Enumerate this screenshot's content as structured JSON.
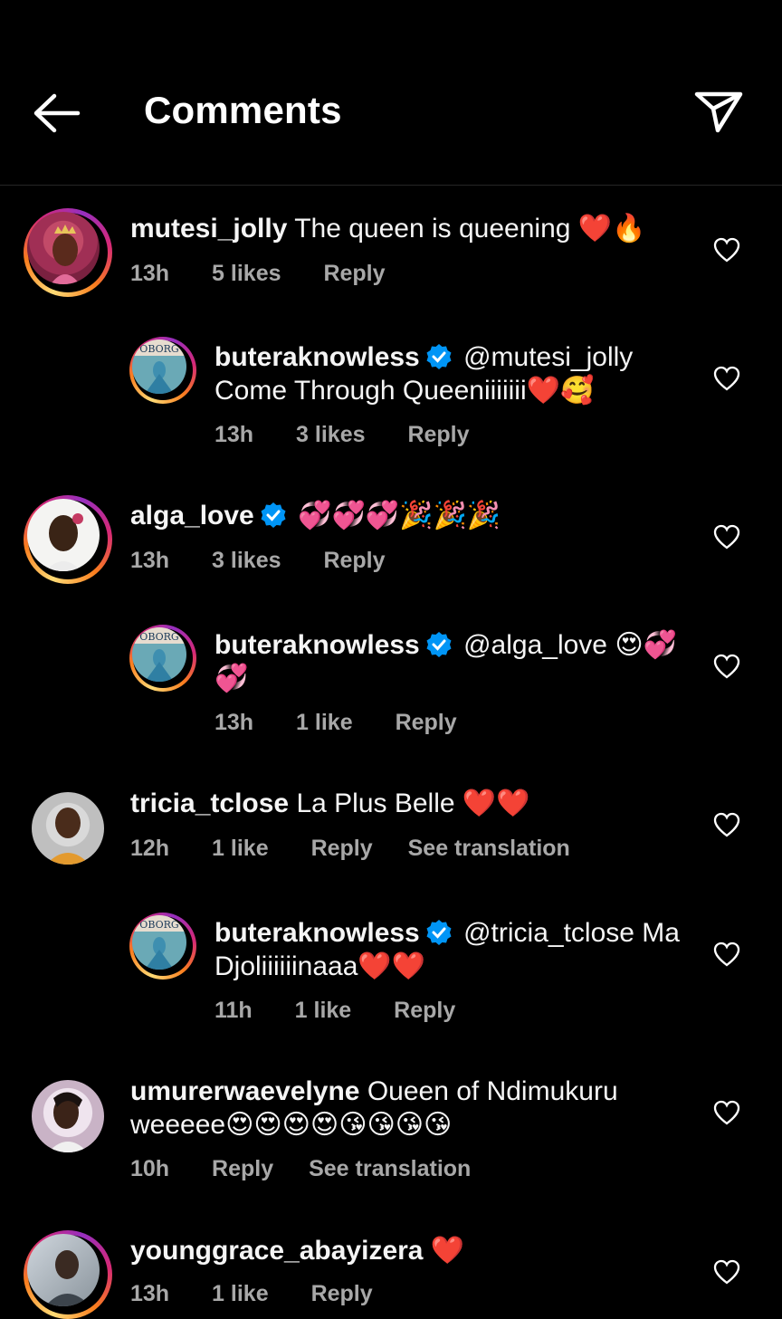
{
  "header": {
    "title": "Comments"
  },
  "comments": [
    {
      "username": "mutesi_jolly",
      "verified": false,
      "text": "The queen is queening",
      "emoji": "❤️🔥",
      "time": "13h",
      "likes": "5 likes",
      "reply": "Reply"
    },
    {
      "username": "buteraknowless",
      "verified": true,
      "text": "@mutesi_jolly",
      "text2": "Come Through Queeniiiiiii",
      "emoji": "❤️🥰",
      "time": "13h",
      "likes": "3 likes",
      "reply": "Reply"
    },
    {
      "username": "alga_love",
      "verified": true,
      "text": "",
      "emoji": "💞💞💞🎉🎉🎉",
      "time": "13h",
      "likes": "3 likes",
      "reply": "Reply"
    },
    {
      "username": "buteraknowless",
      "verified": true,
      "text": "@alga_love",
      "emoji": "😍💞",
      "emoji2": "💞",
      "time": "13h",
      "likes": "1 like",
      "reply": "Reply"
    },
    {
      "username": "tricia_tclose",
      "verified": false,
      "text": "La Plus Belle",
      "emoji": "❤️❤️",
      "time": "12h",
      "likes": "1 like",
      "reply": "Reply",
      "translate": "See translation"
    },
    {
      "username": "buteraknowless",
      "verified": true,
      "text": "@tricia_tclose Ma",
      "text2": "Djoliiiiiinaaa",
      "emoji": "❤️❤️",
      "time": "11h",
      "likes": "1 like",
      "reply": "Reply"
    },
    {
      "username": "umurerwaevelyne",
      "verified": false,
      "text": "Oueen of Ndimukuru",
      "text2": "weeeee",
      "emoji": "😍😍😍😍😘😘😘😘",
      "time": "10h",
      "reply": "Reply",
      "translate": "See translation"
    },
    {
      "username": "younggrace_abayizera",
      "verified": false,
      "text": "",
      "emoji": "❤️",
      "time": "13h",
      "likes": "1 like",
      "reply": "Reply"
    }
  ],
  "colors": {
    "verified": "#0095f6",
    "meta": "#a8a8a8",
    "divider": "#262626"
  },
  "icons": [
    "back-arrow-icon",
    "send-icon",
    "heart-icon",
    "verified-badge-icon"
  ]
}
